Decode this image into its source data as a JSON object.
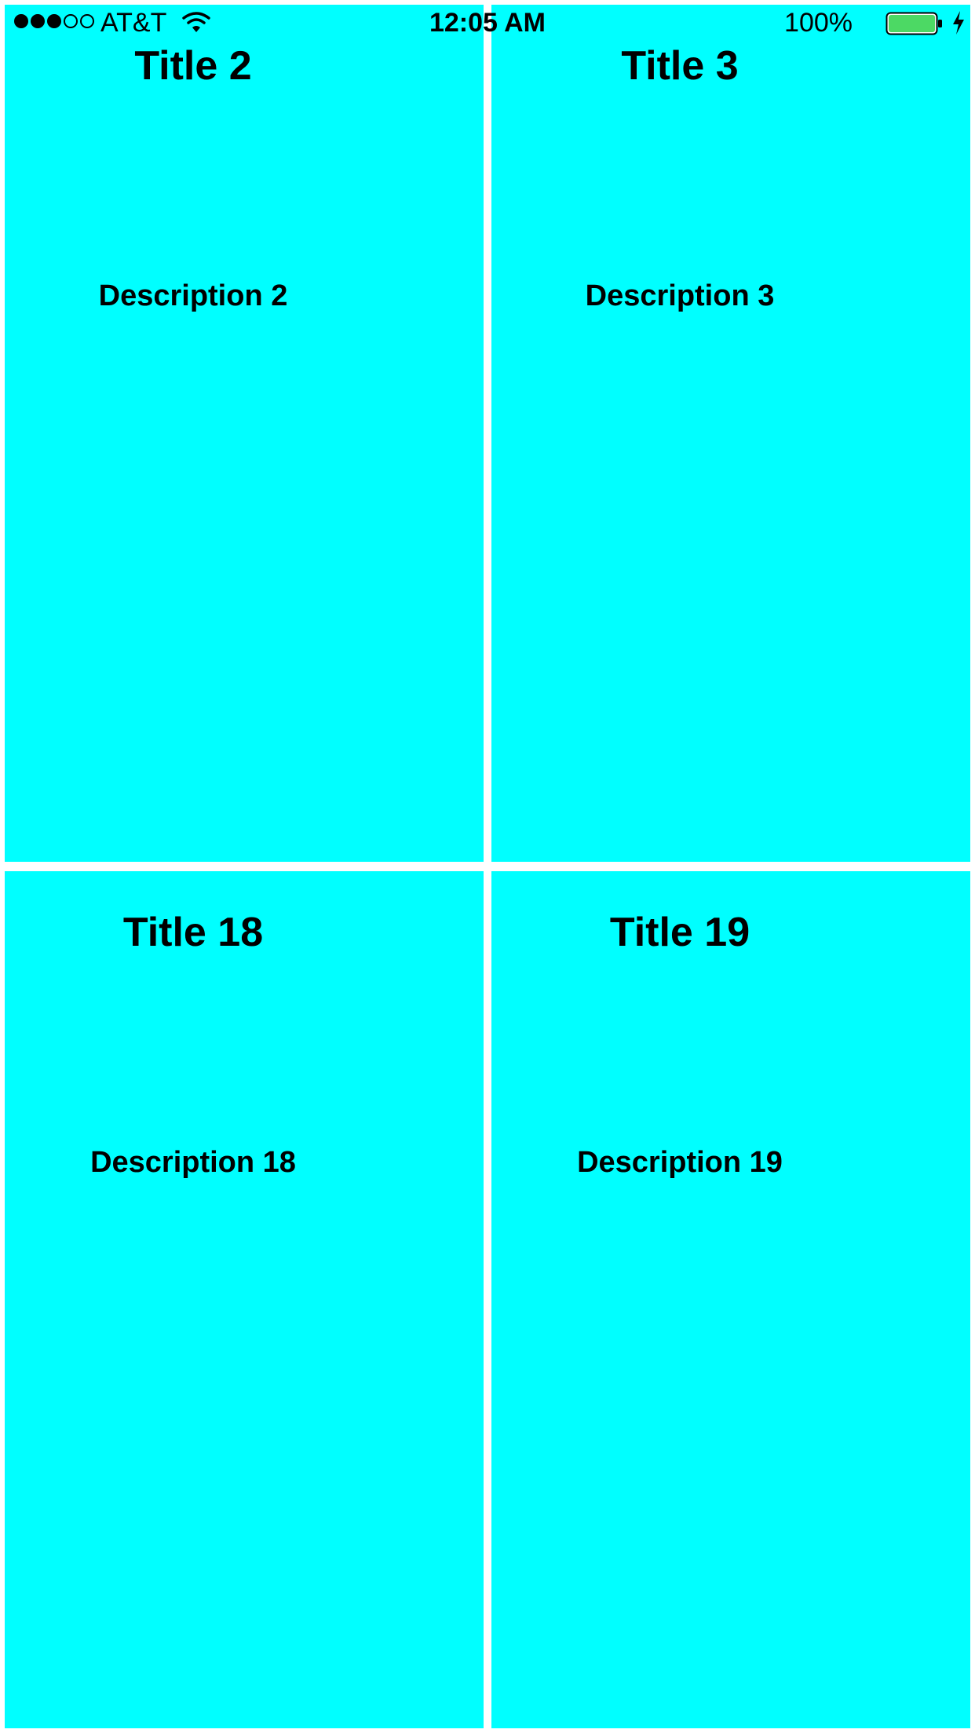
{
  "status_bar": {
    "carrier": "AT&T",
    "time": "12:05 AM",
    "battery_percent": "100%",
    "signal_bars_filled": 3,
    "signal_bars_total": 5,
    "battery_level": 1.0,
    "battery_color": "#4cd964",
    "icons": [
      "signal-dots",
      "wifi-icon",
      "battery-icon",
      "charging-bolt-icon"
    ]
  },
  "background_color": "#00ffff",
  "cells": [
    {
      "title": "Title 2",
      "description": "Description 2"
    },
    {
      "title": "Title 3",
      "description": "Description 3"
    },
    {
      "title": "Title 18",
      "description": "Description 18"
    },
    {
      "title": "Title 19",
      "description": "Description 19"
    }
  ]
}
